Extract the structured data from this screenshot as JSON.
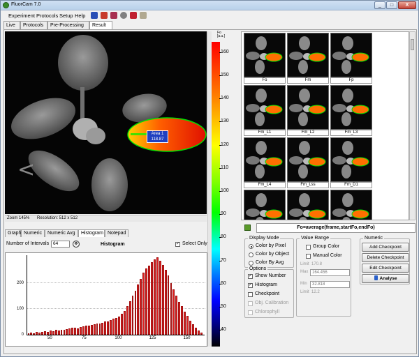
{
  "window": {
    "title": "FluorCam 7.0",
    "min_label": "_",
    "max_label": "□",
    "close_label": "X"
  },
  "menu": {
    "items": [
      "Experiment",
      "Protocols",
      "Setup",
      "Help"
    ]
  },
  "tabs": [
    "Live",
    "Protocols",
    "Pre-Processing",
    "Result"
  ],
  "image_view": {
    "area_label": "Area 1",
    "area_value": "118.87",
    "zoom": "Zoom 145%",
    "resolution": "Resolution: 512 x 512",
    "nav_arrow": "<"
  },
  "colorbar": {
    "unit": "Fo\n[a.u.]",
    "ticks": [
      160,
      150,
      140,
      130,
      120,
      110,
      100,
      90,
      80,
      70,
      60,
      50,
      40
    ],
    "gradient_colors": [
      "#ff0000",
      "#ffff00",
      "#00ff00",
      "#00ffff",
      "#0000ff",
      "#000000"
    ]
  },
  "bottom_tabs": [
    "Graph",
    "Numeric",
    "Numeric Avg",
    "Histogram",
    "Notepad"
  ],
  "histogram_controls": {
    "intervals_label": "Number of Intervals",
    "intervals_value": "64",
    "title": "Histogram",
    "select_only_label": "Select Only",
    "select_only_checked": true
  },
  "chart_data": {
    "type": "bar",
    "title": "Histogram",
    "xlabel": "",
    "ylabel": "",
    "xlim": [
      33,
      163
    ],
    "ylim": [
      0,
      310
    ],
    "x_ticks": [
      50,
      75,
      100,
      125,
      150
    ],
    "y_ticks": [
      0,
      100,
      200
    ],
    "bin_centers": [
      34,
      36,
      38,
      40,
      42,
      44,
      46,
      48,
      50,
      52,
      54,
      56,
      58,
      60,
      62,
      64,
      66,
      68,
      70,
      72,
      74,
      76,
      78,
      80,
      82,
      84,
      86,
      88,
      90,
      92,
      94,
      96,
      98,
      100,
      102,
      104,
      106,
      108,
      110,
      112,
      114,
      116,
      118,
      120,
      122,
      124,
      126,
      128,
      130,
      132,
      134,
      136,
      138,
      140,
      142,
      144,
      146,
      148,
      150,
      152,
      154,
      156,
      158,
      160
    ],
    "values": [
      3,
      8,
      6,
      10,
      8,
      12,
      14,
      12,
      16,
      14,
      18,
      16,
      20,
      18,
      22,
      24,
      26,
      28,
      24,
      30,
      32,
      34,
      36,
      38,
      40,
      42,
      44,
      46,
      50,
      52,
      56,
      62,
      66,
      70,
      80,
      92,
      110,
      130,
      150,
      170,
      195,
      215,
      240,
      255,
      268,
      280,
      290,
      298,
      285,
      270,
      250,
      228,
      200,
      175,
      150,
      128,
      110,
      90,
      72,
      55,
      40,
      28,
      16,
      8
    ],
    "bar_color": "#e02020"
  },
  "thumbnails": [
    "Fo",
    "Fm",
    "Fp",
    "Fm_L1",
    "Fm_L2",
    "Fm_L3",
    "Fm_L4",
    "Fm_Lss",
    "Fm_D1",
    "",
    "",
    ""
  ],
  "formula": "Fo=average(frame,startFo,endFo)",
  "display_mode": {
    "title": "Display Mode",
    "options": [
      "Color by Pixel",
      "Color by Object",
      "Color By Avg"
    ],
    "selected": "Color by Pixel"
  },
  "value_range": {
    "title": "Value Range",
    "group_color_label": "Group Color",
    "manual_color_label": "Manual Color",
    "limit_top_label": "Limit",
    "limit_top_value": "170.8",
    "max_label": "Max",
    "max_value": "164.456",
    "min_label": "Min",
    "min_value": "32.818",
    "limit_bottom_label": "Limit",
    "limit_bottom_value": "12.2"
  },
  "options": {
    "title": "Options",
    "items": [
      {
        "label": "Show Number",
        "checked": true,
        "enabled": true
      },
      {
        "label": "Histogram",
        "checked": true,
        "enabled": true
      },
      {
        "label": "Checkpoint",
        "checked": false,
        "enabled": true
      },
      {
        "label": "Obj. Calibration",
        "checked": false,
        "enabled": false
      },
      {
        "label": "Chlorophyll",
        "checked": false,
        "enabled": false
      }
    ]
  },
  "numeric": {
    "title": "Numeric",
    "buttons": [
      "Add Checkpoint",
      "Delete Checkpoint",
      "Edit Checkpoint"
    ],
    "analyse_label": "Analyse"
  }
}
